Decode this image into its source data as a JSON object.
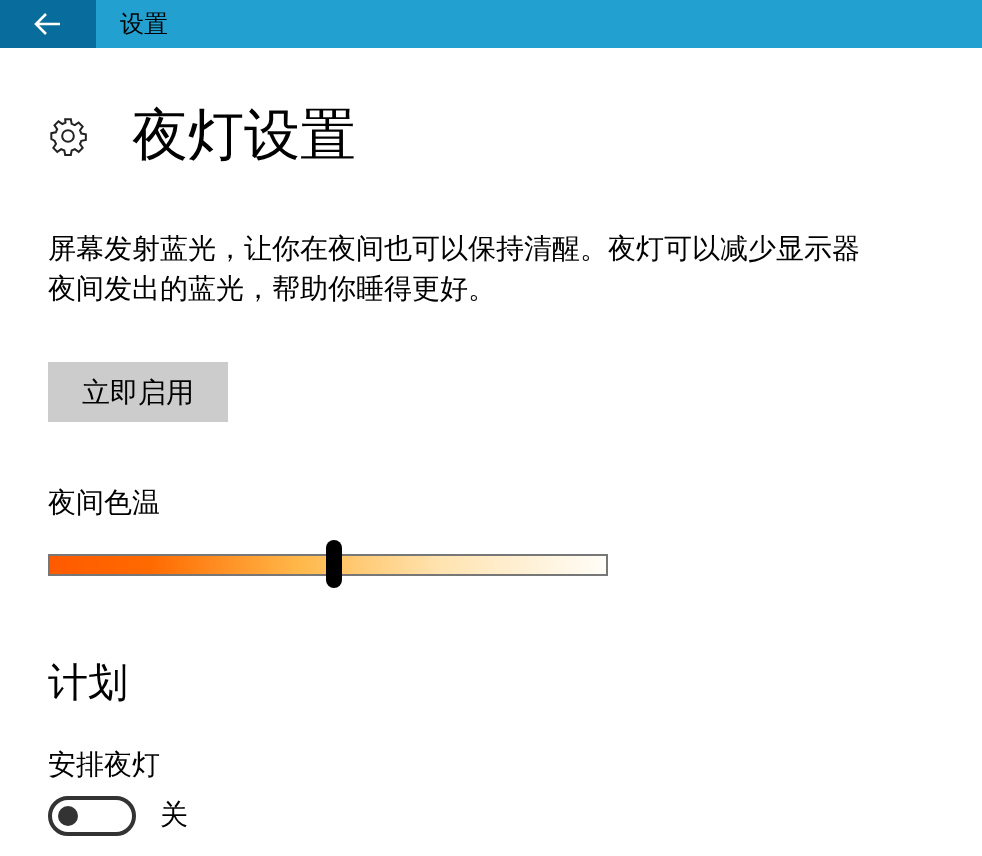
{
  "window": {
    "title": "设置"
  },
  "page": {
    "heading": "夜灯设置",
    "description": "屏幕发射蓝光，让你在夜间也可以保持清醒。夜灯可以减少显示器夜间发出的蓝光，帮助你睡得更好。",
    "enable_button": "立即启用"
  },
  "color_temperature": {
    "label": "夜间色温",
    "level": 0.51
  },
  "schedule": {
    "heading": "计划",
    "toggle_label": "安排夜灯",
    "on": false,
    "state_text": "关"
  }
}
